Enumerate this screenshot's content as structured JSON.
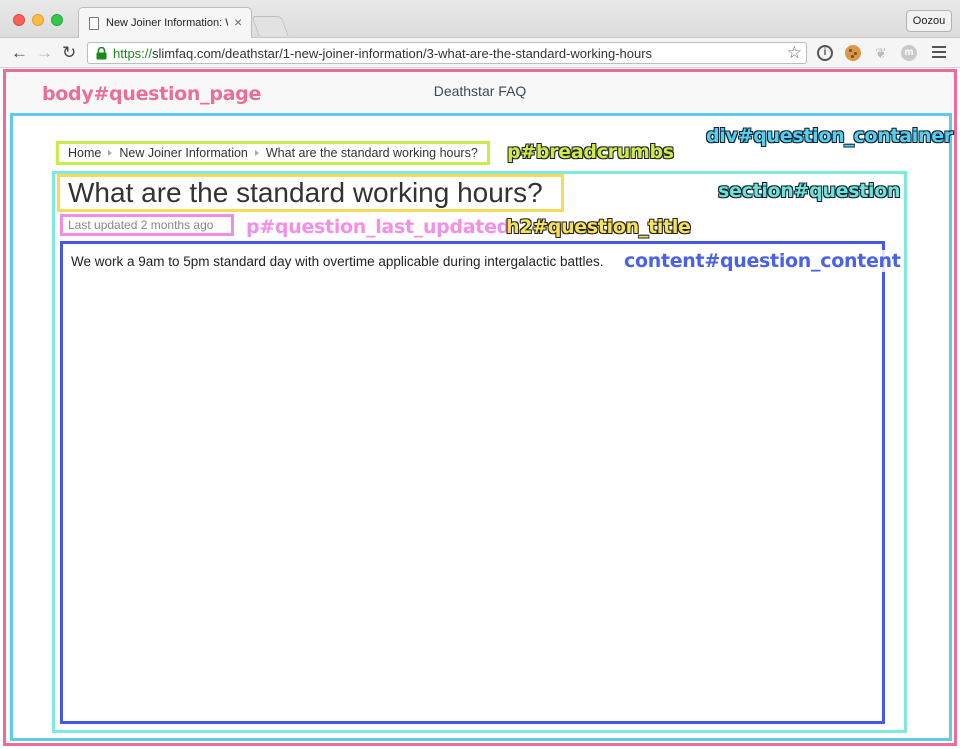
{
  "browser": {
    "tab_title": "New Joiner Information: W",
    "tab_close": "×",
    "profile": "Oozou",
    "url_scheme": "https://",
    "url_rest": "slimfaq.com/deathstar/1-new-joiner-information/3-what-are-the-standard-working-hours"
  },
  "page": {
    "site_title": "Deathstar FAQ",
    "breadcrumbs": [
      "Home",
      "New Joiner Information",
      "What are the standard working hours?"
    ],
    "question_title": "What are the standard working hours?",
    "last_updated": "Last updated 2 months ago",
    "content": "We work a 9am to 5pm standard day with overtime applicable during intergalactic battles."
  },
  "annotations": {
    "body": "body#question_page",
    "container": "div#question_container",
    "breadcrumbs": "p#breadcrumbs",
    "section": "section#question",
    "last_updated": "p#question_last_updated",
    "title": "h2#question_title",
    "content": "content#question_content"
  },
  "colors": {
    "body": "#ee6c96",
    "container": "#5ccbee",
    "section": "#7ee9de",
    "content": "#4459e4",
    "breadcrumbs": "#c9ec4a",
    "title": "#f4dc5a",
    "last_updated": "#f08ee6"
  }
}
